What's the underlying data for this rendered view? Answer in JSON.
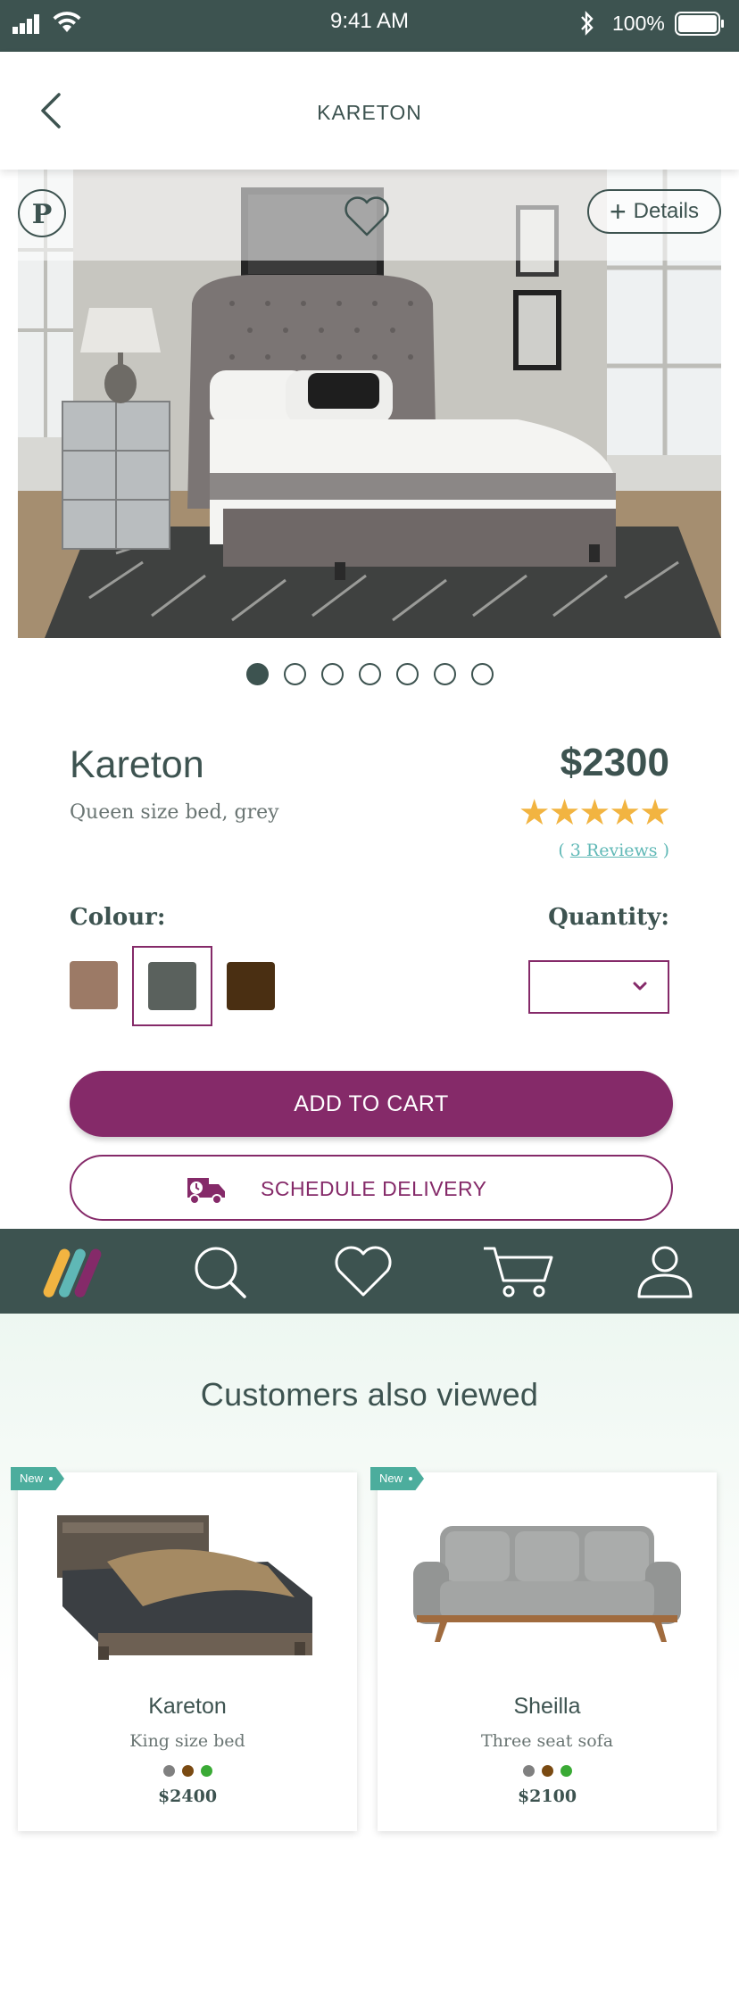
{
  "status_bar": {
    "time": "9:41 AM",
    "battery": "100%"
  },
  "header": {
    "title": "KARETON"
  },
  "hero": {
    "details_label": "Details",
    "pinterest_glyph": "P",
    "active_slide": 1,
    "slide_count": 7
  },
  "product": {
    "name": "Kareton",
    "subtitle": "Queen size bed, grey",
    "price": "$2300",
    "rating": 5,
    "stars": "★★★★★",
    "reviews_open": "( ",
    "reviews_link": "3 Reviews",
    "reviews_close": " )",
    "colour_label": "Colour:",
    "quantity_label": "Quantity:",
    "quantity_value": "",
    "colours": [
      "#9c7a66",
      "#5a615d",
      "#4a2f12"
    ],
    "selected_colour_index": 1
  },
  "actions": {
    "add_to_cart": "ADD TO CART",
    "schedule_delivery": "SCHEDULE DELIVERY"
  },
  "tab_bar": {
    "items": [
      "home-logo-icon",
      "search-icon",
      "heart-icon",
      "cart-icon",
      "profile-icon"
    ]
  },
  "also_viewed": {
    "title": "Customers also viewed",
    "items": [
      {
        "badge": "New",
        "name": "Kareton",
        "description": "King size bed",
        "price": "$2400",
        "colours": [
          "#808080",
          "#7a4a12",
          "#3aaa35"
        ]
      },
      {
        "badge": "New",
        "name": "Sheilla",
        "description": "Three seat sofa",
        "price": "$2100",
        "colours": [
          "#808080",
          "#7a4a12",
          "#3aaa35"
        ]
      }
    ]
  },
  "colors": {
    "primary": "#3d5350",
    "accent": "#852a69",
    "star": "#f2b441",
    "link": "#5fb8b6",
    "badge": "#4cad9d"
  }
}
